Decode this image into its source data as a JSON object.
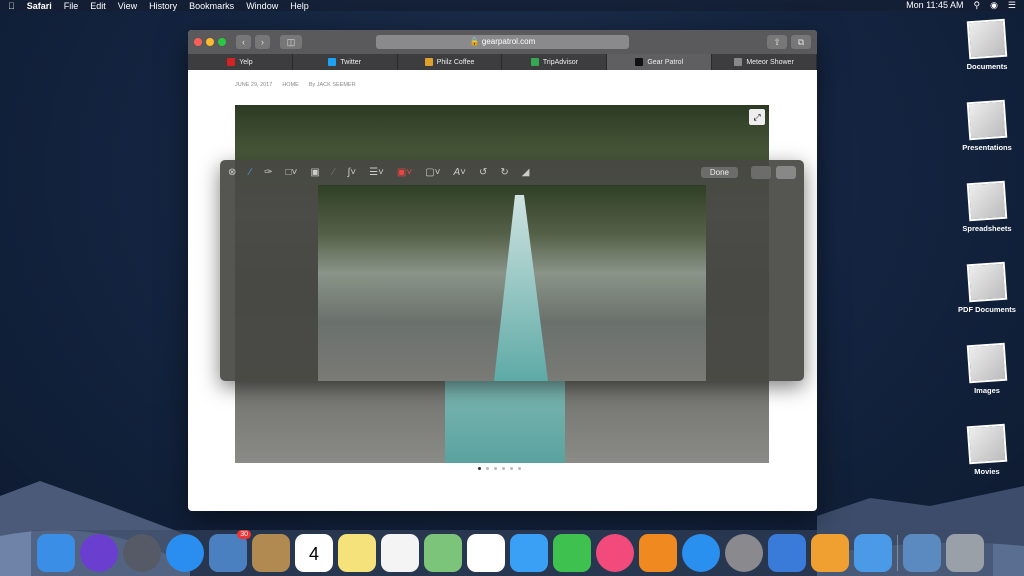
{
  "menubar": {
    "app": "Safari",
    "items": [
      "File",
      "Edit",
      "View",
      "History",
      "Bookmarks",
      "Window",
      "Help"
    ],
    "clock": "Mon 11:45 AM"
  },
  "browser": {
    "url": "gearpatrol.com",
    "tabs": [
      {
        "label": "Yelp",
        "color": "#d32323"
      },
      {
        "label": "Twitter",
        "color": "#1da1f2"
      },
      {
        "label": "Philz Coffee",
        "color": "#e0a030"
      },
      {
        "label": "TripAdvisor",
        "color": "#34a853"
      },
      {
        "label": "Gear Patrol",
        "color": "#111111",
        "active": true
      },
      {
        "label": "Meteor Shower",
        "color": "#888888"
      }
    ],
    "byline": {
      "date": "JUNE 29, 2017",
      "section": "HOME",
      "author": "By JACK SEEMER"
    }
  },
  "markup": {
    "done_label": "Done"
  },
  "stacks": [
    "Documents",
    "Presentations",
    "Spreadsheets",
    "PDF Documents",
    "Images",
    "Movies"
  ],
  "dock": [
    {
      "name": "finder",
      "color": "#3a8ee6"
    },
    {
      "name": "siri",
      "color": "#6a3fd0"
    },
    {
      "name": "launchpad",
      "color": "#555a66"
    },
    {
      "name": "safari",
      "color": "#2a8ef0"
    },
    {
      "name": "mail",
      "color": "#4a80c0",
      "badge": "30"
    },
    {
      "name": "contacts",
      "color": "#b08a50"
    },
    {
      "name": "calendar",
      "color": "#ffffff",
      "text": "4"
    },
    {
      "name": "notes",
      "color": "#f6e27a"
    },
    {
      "name": "reminders",
      "color": "#f4f4f4"
    },
    {
      "name": "maps",
      "color": "#7cc47a"
    },
    {
      "name": "photos",
      "color": "#ffffff"
    },
    {
      "name": "messages",
      "color": "#3aa0f5"
    },
    {
      "name": "facetime",
      "color": "#3ec14f"
    },
    {
      "name": "itunes",
      "color": "#f24a7a"
    },
    {
      "name": "ibooks",
      "color": "#f08a20"
    },
    {
      "name": "app-store",
      "color": "#2a90f0"
    },
    {
      "name": "system-preferences",
      "color": "#8a8a8e"
    },
    {
      "name": "keynote",
      "color": "#3a7ad8"
    },
    {
      "name": "pages",
      "color": "#f0a030"
    },
    {
      "name": "xcode",
      "color": "#4a9ae8"
    },
    {
      "name": "downloads",
      "color": "#5a8ac0"
    },
    {
      "name": "trash",
      "color": "#9aa0a8"
    }
  ]
}
